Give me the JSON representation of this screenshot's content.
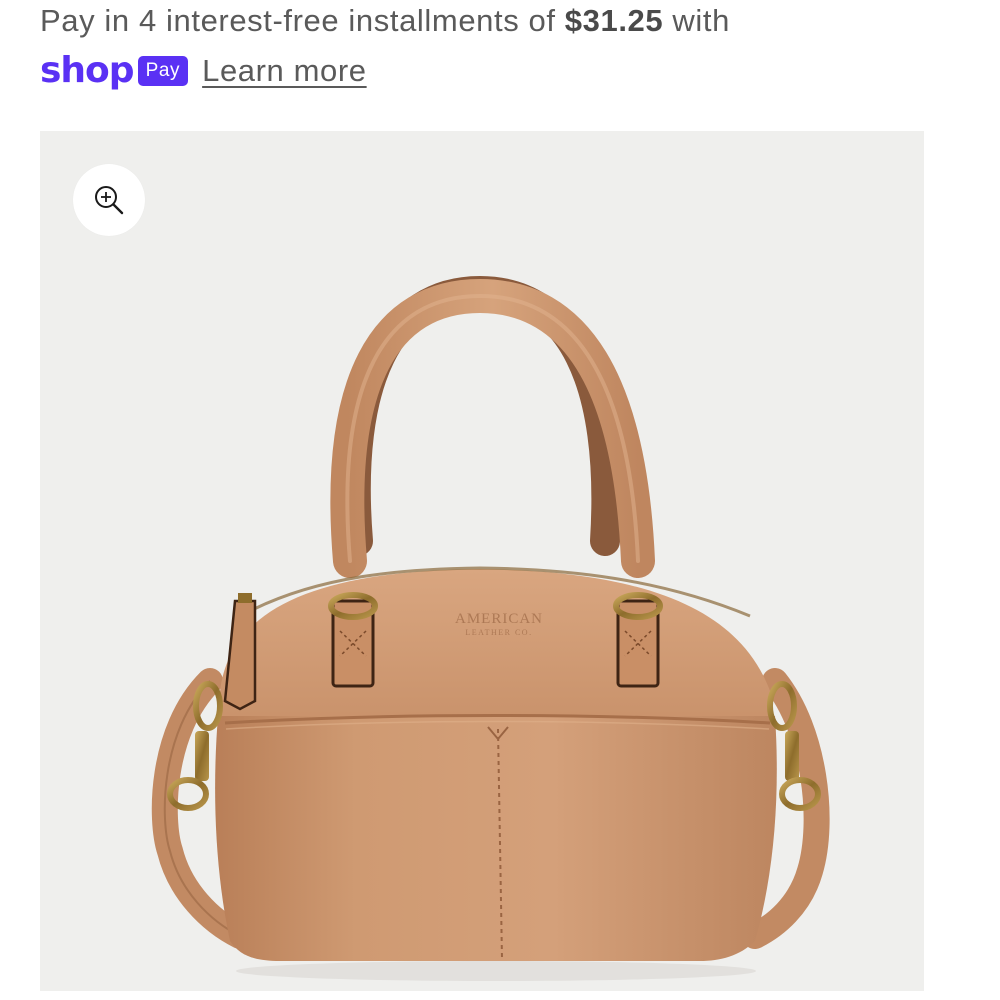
{
  "installments": {
    "prefix": "Pay in 4 interest-free installments of ",
    "amount": "$31.25",
    "suffix": " with",
    "shop_word": "shop",
    "pay_badge": "Pay",
    "learn_more": "Learn more"
  },
  "product_image": {
    "alt": "Tan leather satchel handbag",
    "brand_embossing": "AMERICAN LEATHER CO.",
    "background_color": "#efefed",
    "leather_color": "#c8916a"
  },
  "zoom_button": {
    "icon": "zoom-in-icon",
    "aria_label": "Zoom"
  },
  "colors": {
    "shop_purple": "#5a31f4",
    "text_gray": "#5a5a5a"
  }
}
